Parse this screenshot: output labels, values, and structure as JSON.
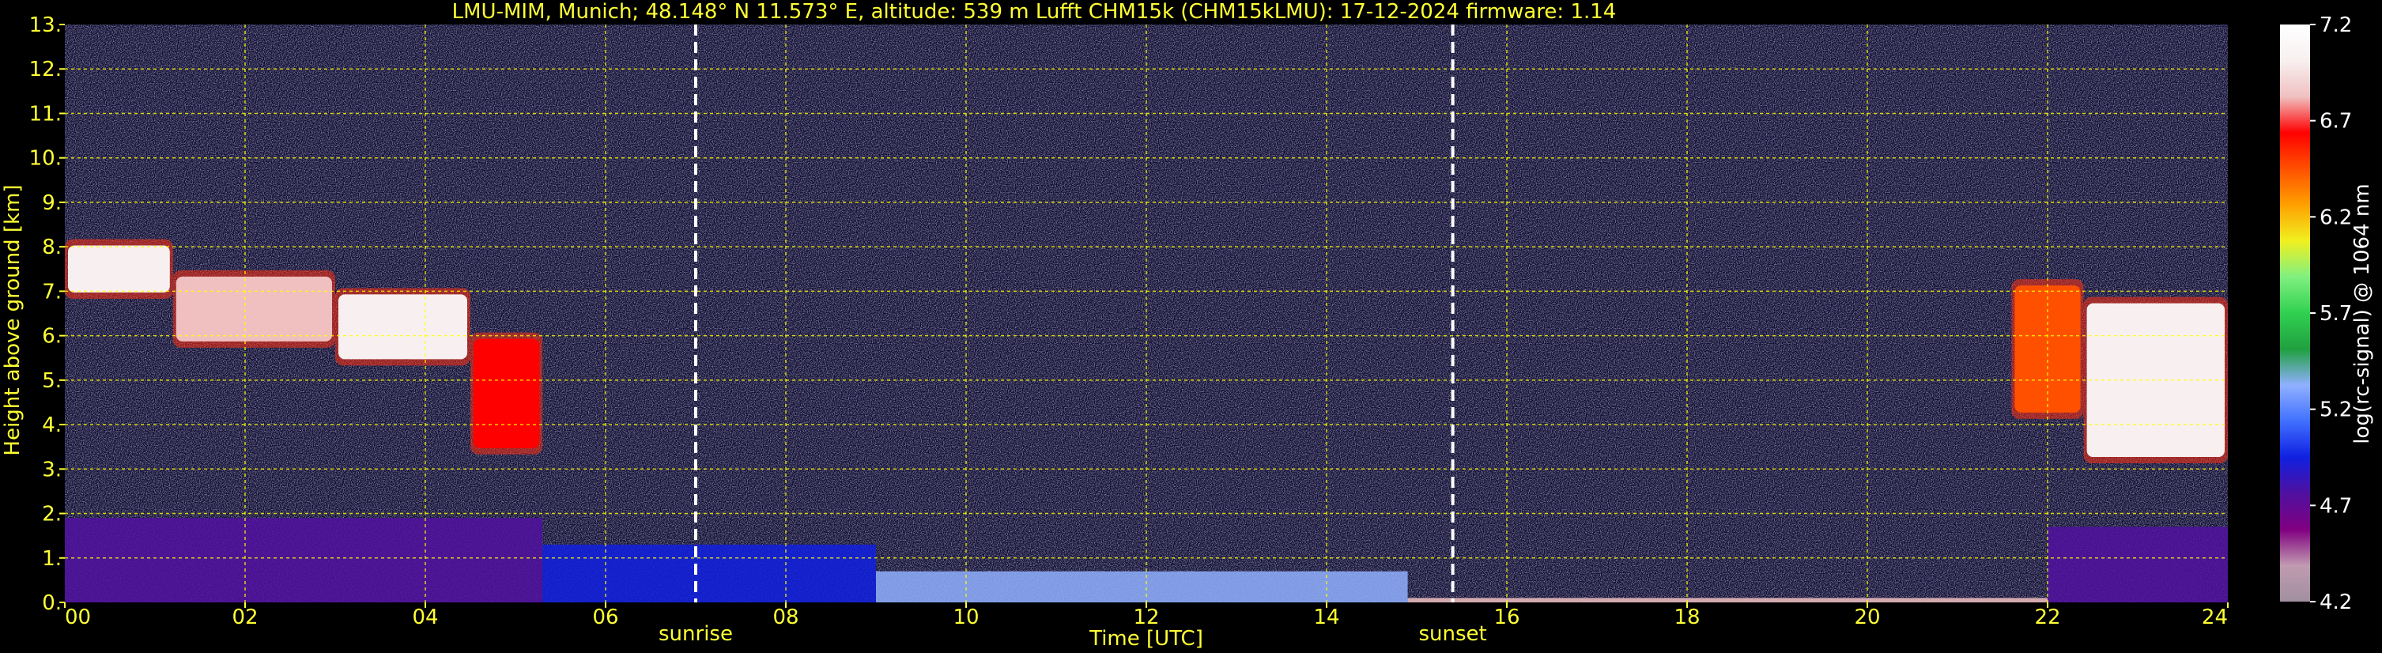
{
  "chart_data": {
    "type": "heatmap",
    "title": "LMU-MIM, Munich; 48.148° N 11.573° E, altitude: 539 m    Lufft CHM15k (CHM15kLMU): 17-12-2024    firmware: 1.14",
    "xlabel": "Time [UTC]",
    "ylabel": "Height above ground [km]",
    "colorbar_label": "log(rc-signal) @ 1064 nm",
    "xlim": [
      0,
      24
    ],
    "ylim": [
      0,
      13
    ],
    "x_ticks": [
      {
        "value": 0,
        "label": "00"
      },
      {
        "value": 2,
        "label": "02"
      },
      {
        "value": 4,
        "label": "04"
      },
      {
        "value": 6,
        "label": "06"
      },
      {
        "value": 8,
        "label": "08"
      },
      {
        "value": 10,
        "label": "10"
      },
      {
        "value": 12,
        "label": "12"
      },
      {
        "value": 14,
        "label": "14"
      },
      {
        "value": 16,
        "label": "16"
      },
      {
        "value": 18,
        "label": "18"
      },
      {
        "value": 20,
        "label": "20"
      },
      {
        "value": 22,
        "label": "22"
      },
      {
        "value": 24,
        "label": "24"
      }
    ],
    "y_ticks": [
      {
        "value": 0,
        "label": "0."
      },
      {
        "value": 1,
        "label": "1."
      },
      {
        "value": 2,
        "label": "2."
      },
      {
        "value": 3,
        "label": "3."
      },
      {
        "value": 4,
        "label": "4."
      },
      {
        "value": 5,
        "label": "5."
      },
      {
        "value": 6,
        "label": "6."
      },
      {
        "value": 7,
        "label": "7."
      },
      {
        "value": 8,
        "label": "8."
      },
      {
        "value": 9,
        "label": "9."
      },
      {
        "value": 10,
        "label": "10."
      },
      {
        "value": 11,
        "label": "11."
      },
      {
        "value": 12,
        "label": "12."
      },
      {
        "value": 13,
        "label": "13."
      }
    ],
    "colorbar": {
      "range": [
        4.2,
        7.2
      ],
      "ticks": [
        {
          "value": 7.2,
          "label": "7.2"
        },
        {
          "value": 6.7,
          "label": "6.7"
        },
        {
          "value": 6.2,
          "label": "6.2"
        },
        {
          "value": 5.7,
          "label": "5.7"
        },
        {
          "value": 5.2,
          "label": "5.2"
        },
        {
          "value": 4.7,
          "label": "4.7"
        },
        {
          "value": 4.2,
          "label": "4.2"
        }
      ]
    },
    "events": [
      {
        "name": "sunrise",
        "time": 7.0
      },
      {
        "name": "sunset",
        "time": 15.4
      }
    ],
    "grid": true,
    "cloud_layers": [
      {
        "start": 0.0,
        "end": 1.2,
        "base": 6.9,
        "top": 8.1,
        "intensity": 7.0
      },
      {
        "start": 1.2,
        "end": 3.0,
        "base": 5.8,
        "top": 7.4,
        "intensity": 6.8
      },
      {
        "start": 3.0,
        "end": 4.5,
        "base": 5.4,
        "top": 7.0,
        "intensity": 7.0
      },
      {
        "start": 4.5,
        "end": 5.3,
        "base": 3.4,
        "top": 6.0,
        "intensity": 6.6
      },
      {
        "start": 21.6,
        "end": 22.4,
        "base": 4.2,
        "top": 7.2,
        "intensity": 6.5
      },
      {
        "start": 22.4,
        "end": 24.0,
        "base": 3.2,
        "top": 6.8,
        "intensity": 7.0
      }
    ],
    "boundary_layer": [
      {
        "start": 0.0,
        "end": 5.3,
        "top": 1.9,
        "intensity": 4.8
      },
      {
        "start": 5.3,
        "end": 9.0,
        "top": 1.3,
        "intensity": 4.9
      },
      {
        "start": 9.0,
        "end": 14.9,
        "top": 0.7,
        "intensity": 5.3
      },
      {
        "start": 14.9,
        "end": 22.0,
        "top": 0.1,
        "intensity": 6.8
      },
      {
        "start": 22.0,
        "end": 24.0,
        "top": 1.7,
        "intensity": 4.8
      }
    ]
  },
  "colors": {
    "background": "#000000",
    "text": "#ffff33",
    "grid": "#ffff00",
    "colorbar_stops": [
      "#a090a0",
      "#c09ab0",
      "#800080",
      "#5010a0",
      "#1020e0",
      "#4070ff",
      "#90b0ff",
      "#20a040",
      "#30d050",
      "#80f080",
      "#f0f020",
      "#ffa000",
      "#ff5000",
      "#ff0000",
      "#f0c0c0",
      "#f8f0f0",
      "#ffffff"
    ]
  }
}
